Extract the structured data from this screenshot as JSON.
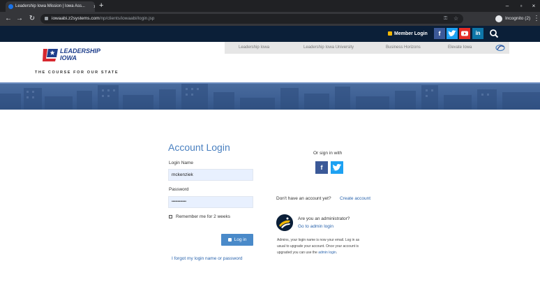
{
  "browser": {
    "tab_title": "Leadership Iowa Mission | Iowa Ass...",
    "url_host": "iowaabi.z2systems.com",
    "url_path": "/np/clients/iowaabi/login.jsp",
    "incognito_label": "Incognito (2)"
  },
  "topbar": {
    "member_login": "Member Login",
    "social": [
      "f",
      "t",
      "yt",
      "in"
    ]
  },
  "header": {
    "logo_line1": "LEADERSHIP",
    "logo_line2": "IOWA",
    "tagline": "THE COURSE FOR OUR STATE",
    "nav": [
      "Leadership Iowa",
      "Leadership Iowa University",
      "Business Horizons",
      "Elevate Iowa"
    ]
  },
  "login": {
    "title": "Account Login",
    "username_label": "Login Name",
    "username_value": "mckenziek",
    "password_label": "Password",
    "password_value": "••••••••••••",
    "remember_label": "Remember me for 2 weeks",
    "login_button": "Log in",
    "forgot_link": "I forgot my login name or password"
  },
  "alt": {
    "or_sign_in": "Or sign in with",
    "no_account": "Don't have an account yet?",
    "create_account": "Create account",
    "admin_q": "Are you an administrator?",
    "admin_link": "Go to admin login",
    "note1": "Admins, your login name is now your email. Log in as",
    "note2": "usual to upgrade your account. Once your account is",
    "note3_pre": "upgraded you can use the",
    "note3_link": "admin login",
    "note3_post": "."
  },
  "colors": {
    "accent": "#4a80c0",
    "navy": "#0b1f38",
    "facebook": "#3b5998",
    "twitter": "#1da1f2",
    "youtube": "#e52d27",
    "linkedin": "#0e76a8"
  }
}
